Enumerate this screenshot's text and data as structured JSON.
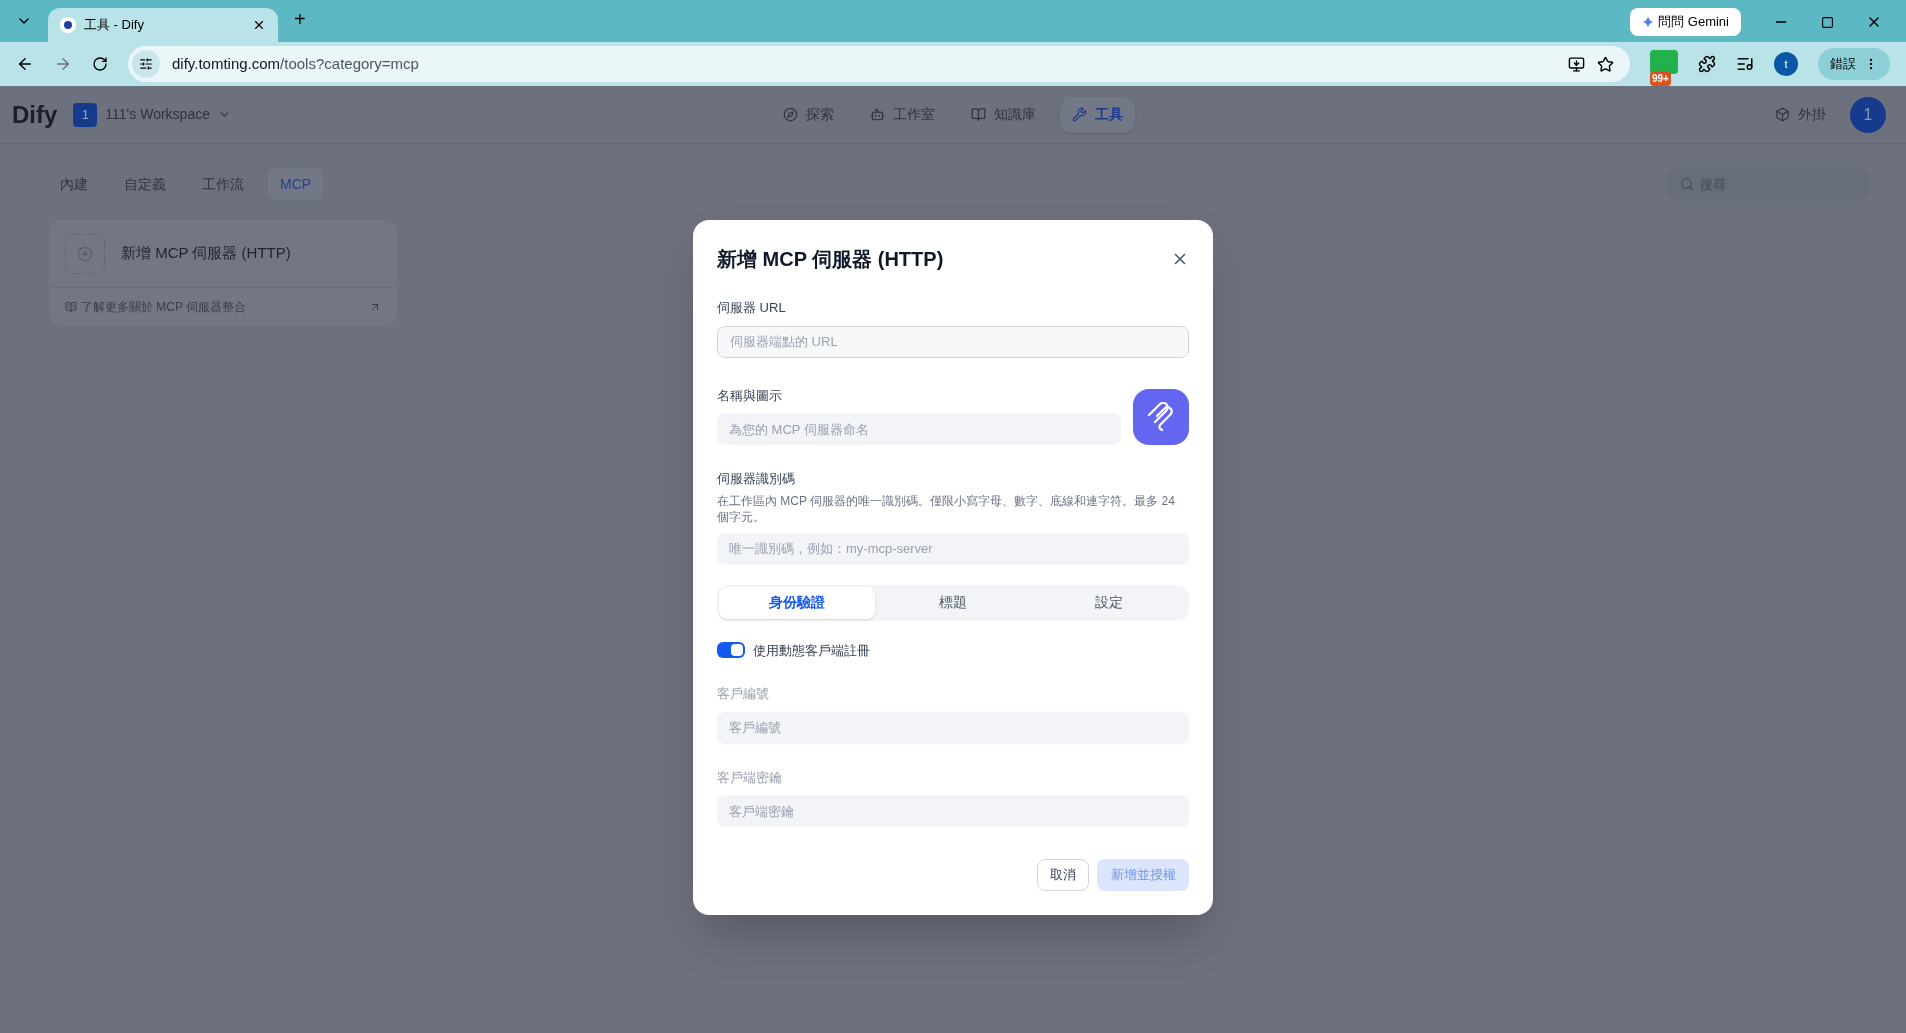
{
  "browser": {
    "tabs": [
      {
        "title": "工具 - Dify",
        "selected": true
      }
    ],
    "new_tab": "+",
    "url_host": "dify.tomting.com",
    "url_path": "/tools?category=mcp",
    "gemini": "問問 Gemini",
    "extension_badge": "99+",
    "profile": "t",
    "error_button": "錯誤"
  },
  "app": {
    "logo": "Dify",
    "workspace": {
      "badge": "1",
      "name": "111's Workspace"
    },
    "nav": [
      {
        "label": "探索",
        "selected": false
      },
      {
        "label": "工作室",
        "selected": false
      },
      {
        "label": "知識庫",
        "selected": false
      },
      {
        "label": "工具",
        "selected": true
      }
    ],
    "plugins": "外掛",
    "avatar": "1",
    "category_tabs": [
      {
        "label": "內建",
        "selected": false
      },
      {
        "label": "自定義",
        "selected": false
      },
      {
        "label": "工作流",
        "selected": false
      },
      {
        "label": "MCP",
        "selected": true
      }
    ],
    "search": {
      "placeholder": "搜尋"
    },
    "card": {
      "title": "新增 MCP 伺服器 (HTTP)",
      "link": "了解更多關於 MCP 伺服器整合"
    }
  },
  "dialog": {
    "title": "新增 MCP 伺服器 (HTTP)",
    "url": {
      "label": "伺服器 URL",
      "placeholder": "伺服器端點的 URL"
    },
    "name": {
      "label": "名稱與圖示",
      "placeholder": "為您的 MCP 伺服器命名"
    },
    "identifier": {
      "label": "伺服器識別碼",
      "help": "在工作區內 MCP 伺服器的唯一識別碼。僅限小寫字母、數字、底線和連字符。最多 24 個字元。",
      "placeholder": "唯一識別碼，例如：my-mcp-server"
    },
    "tabs": [
      {
        "label": "身份驗證",
        "selected": true
      },
      {
        "label": "標題",
        "selected": false
      },
      {
        "label": "設定",
        "selected": false
      }
    ],
    "dynamic_registration": {
      "label": "使用動態客戶端註冊",
      "on": true
    },
    "client_id": {
      "label": "客戶編號",
      "placeholder": "客戶編號",
      "disabled": true
    },
    "client_secret": {
      "label": "客戶端密鑰",
      "placeholder": "客戶端密鑰",
      "disabled": true
    },
    "cancel": "取消",
    "submit": {
      "label": "新增並授權",
      "disabled": true
    }
  }
}
